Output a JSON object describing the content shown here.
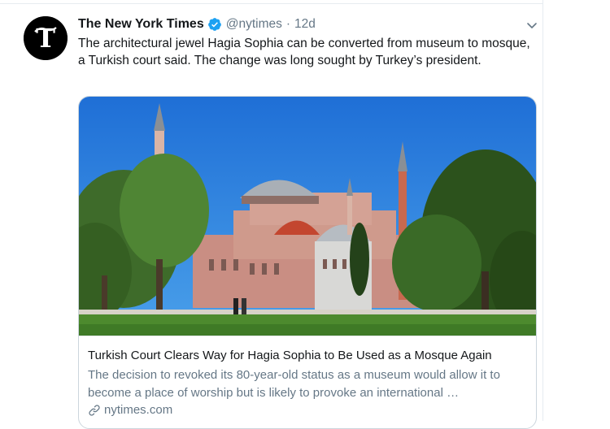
{
  "tweet": {
    "author": {
      "display_name": "The New York Times",
      "handle": "@nytimes",
      "verified": true,
      "avatar_letter": "T"
    },
    "separator": "·",
    "time": "12d",
    "text": "The architectural jewel Hagia Sophia can be converted from museum to mosque, a Turkish court said. The change was long sought by Turkey’s president.",
    "card": {
      "image_subject": "hagia-sophia-photo",
      "title": "Turkish Court Clears Way for Hagia Sophia to Be Used as a Mosque Again",
      "description": "The decision to revoked its 80-year-old status as a museum would allow it to become a place of worship but is likely to provoke an international …",
      "domain": "nytimes.com"
    }
  },
  "icons": {
    "verified": "verified-badge-icon",
    "menu": "chevron-down-icon",
    "link": "link-icon"
  },
  "colors": {
    "accent": "#1da1f2",
    "text_primary": "#14171a",
    "text_secondary": "#657786",
    "border": "#ccd6dd"
  }
}
